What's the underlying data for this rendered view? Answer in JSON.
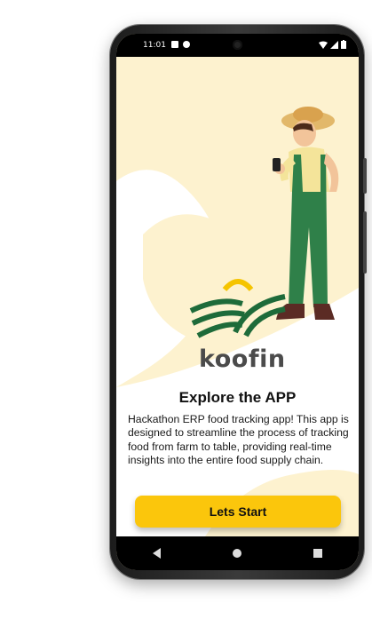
{
  "status": {
    "time": "11:01",
    "icons": [
      "notification-a-icon",
      "notification-f-icon",
      "wifi-icon",
      "signal-icon",
      "battery-icon"
    ]
  },
  "brand": {
    "name": "koofin"
  },
  "onboarding": {
    "title": "Explore the APP",
    "description": "Hackathon ERP food tracking app! This app is designed to streamline the process of tracking food from farm to table, providing real-time insights into the entire food supply chain.",
    "button_label": "Lets Start"
  },
  "colors": {
    "background": "#fdf2cf",
    "accent": "#fbc60c",
    "logo_green": "#1e6b3a",
    "logo_yellow": "#f5c400",
    "text": "#111111"
  },
  "nav": {
    "items": [
      "back-icon",
      "home-icon",
      "recents-icon"
    ]
  }
}
